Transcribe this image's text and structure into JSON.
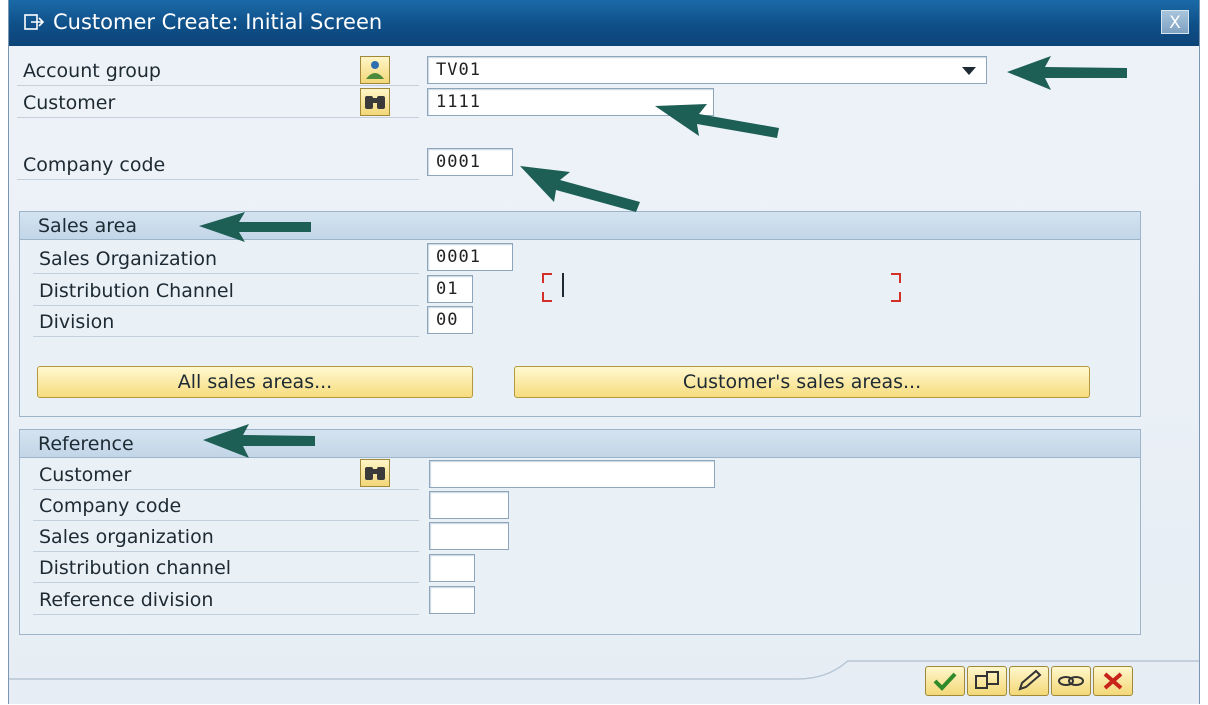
{
  "window": {
    "title": "Customer Create: Initial Screen",
    "close_label": "X"
  },
  "header_fields": {
    "account_group": {
      "label": "Account group",
      "value": "TV01"
    },
    "customer": {
      "label": "Customer",
      "value": "1111"
    },
    "company_code": {
      "label": "Company code",
      "value": "0001"
    }
  },
  "sales_area": {
    "title": "Sales area",
    "sales_organization": {
      "label": "Sales Organization",
      "value": "0001"
    },
    "distribution_channel": {
      "label": "Distribution Channel",
      "value": "01"
    },
    "division": {
      "label": "Division",
      "value": "00"
    },
    "all_sales_areas_button": "All sales areas...",
    "customers_sales_areas_button": "Customer's sales areas..."
  },
  "reference": {
    "title": "Reference",
    "customer": {
      "label": "Customer",
      "value": ""
    },
    "company_code": {
      "label": "Company code",
      "value": ""
    },
    "sales_organization": {
      "label": "Sales organization",
      "value": ""
    },
    "distribution_channel": {
      "label": "Distribution channel",
      "value": ""
    },
    "reference_division": {
      "label": "Reference division",
      "value": ""
    }
  },
  "icons": {
    "title": "window-icon",
    "account_group_button": "account-group-icon",
    "search": "binoculars-icon",
    "toolbar": [
      "check-icon",
      "copy-icon",
      "edit-icon",
      "link-icon",
      "cancel-icon"
    ]
  },
  "colors": {
    "title_bar": "#0f4f88",
    "annotation_arrow": "#1d5e55",
    "button_yellow": "#f7dc7e",
    "marker_red": "#d4302a"
  }
}
